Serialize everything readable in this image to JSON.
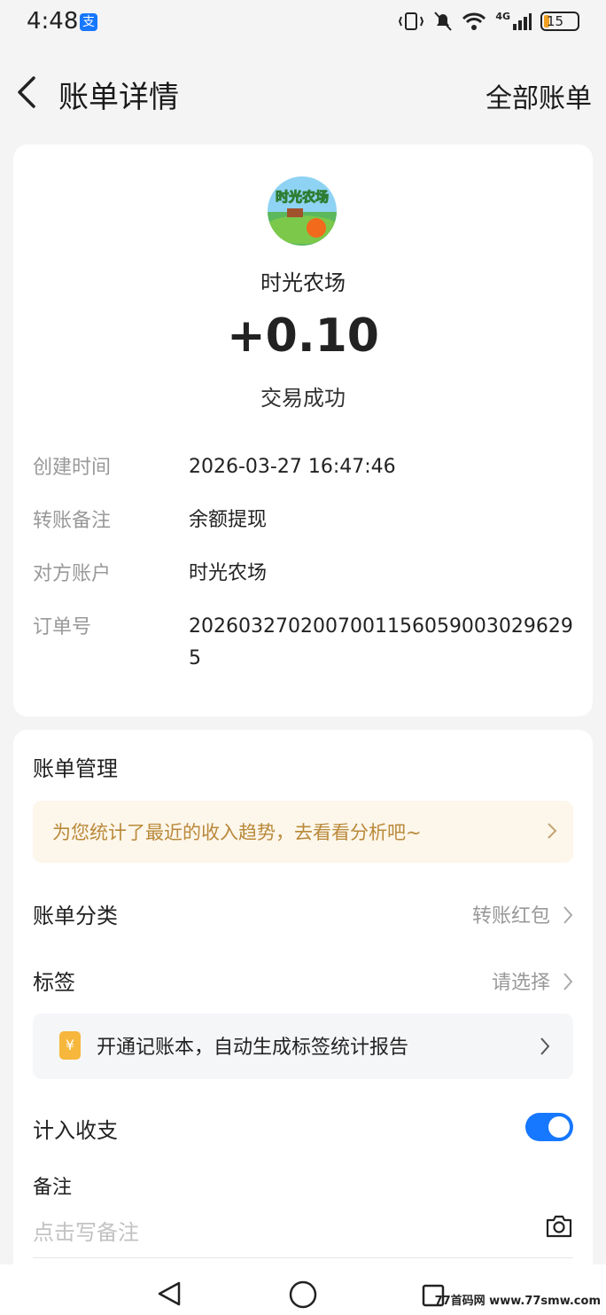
{
  "status_bar": {
    "time": "4:48",
    "app_badge": "支",
    "network": "4G",
    "battery": "15"
  },
  "nav": {
    "title": "账单详情",
    "right_link": "全部账单"
  },
  "transaction": {
    "merchant_logo_text": "时光农场",
    "merchant": "时光农场",
    "amount": "+0.10",
    "status": "交易成功",
    "details": [
      {
        "label": "创建时间",
        "value": "2026-03-27 16:47:46"
      },
      {
        "label": "转账备注",
        "value": "余额提现"
      },
      {
        "label": "对方账户",
        "value": "时光农场"
      },
      {
        "label": "订单号",
        "value": "20260327020070011560590030296295"
      }
    ]
  },
  "management": {
    "title": "账单管理",
    "promo": "为您统计了最近的收入趋势，去看看分析吧~",
    "category_label": "账单分类",
    "category_value": "转账红包",
    "tag_label": "标签",
    "tag_value": "请选择",
    "ledger_icon": "¥",
    "ledger_text": "开通记账本，自动生成标签统计报告",
    "include_label": "计入收支",
    "include_enabled": true,
    "note_label": "备注",
    "note_placeholder": "点击写备注"
  },
  "watermark": "77首码网 www.77smw.com",
  "colors": {
    "accent": "#1677ff",
    "promo_bg": "#fdf6ea",
    "promo_text": "#b9893a"
  }
}
